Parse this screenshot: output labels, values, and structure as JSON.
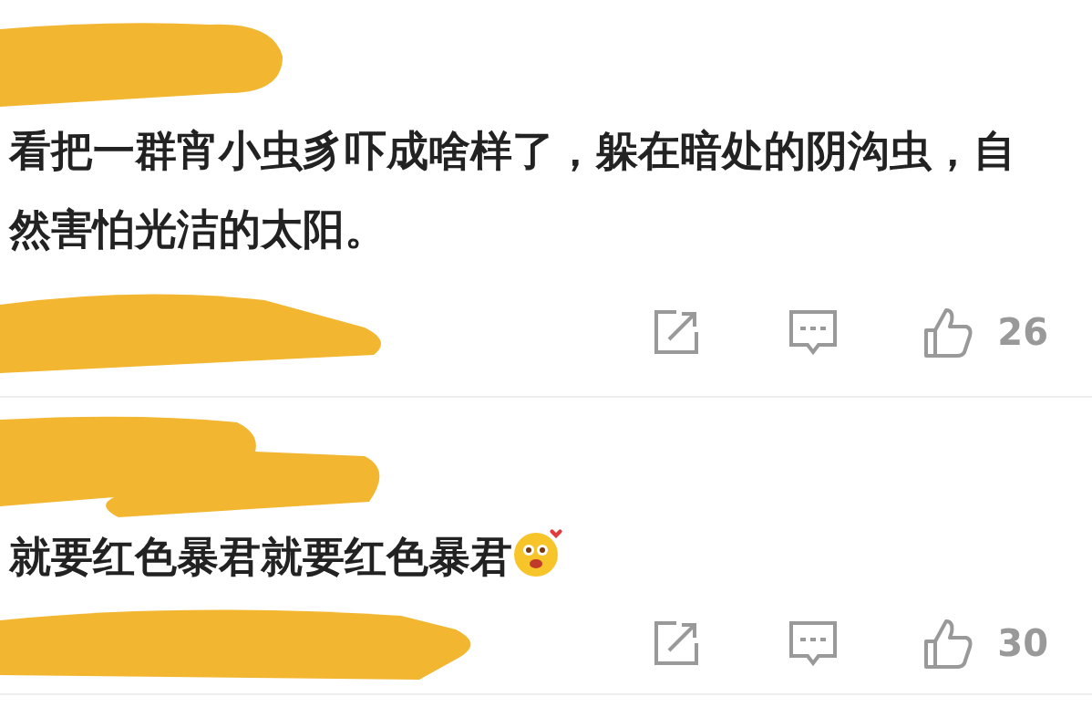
{
  "comments": [
    {
      "text": "看把一群宵小虫豸吓成啥样了，躲在暗处的阴沟虫，自然害怕光洁的太阳。",
      "likes": "26"
    },
    {
      "text": "就要红色暴君就要红色暴君",
      "emoji": true,
      "likes": "30"
    }
  ]
}
